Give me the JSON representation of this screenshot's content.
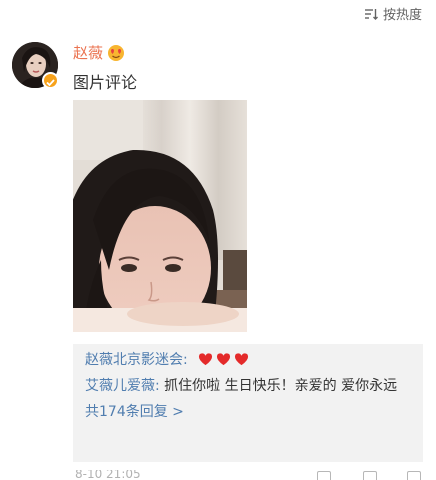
{
  "header": {
    "sort_label": "按热度",
    "sort_icon": "sort-lines-icon"
  },
  "comment": {
    "author": "赵薇",
    "author_badge_icon": "heart-eyes-emoji-icon",
    "verified_icon": "verified-check-icon",
    "text": "图片评论",
    "image": "selfie-photo"
  },
  "replies": {
    "items": [
      {
        "user": "赵薇北京影迷会:",
        "text": "",
        "emoji": [
          "red-heart-icon",
          "red-heart-icon",
          "red-heart-icon"
        ]
      },
      {
        "user": "艾薇儿爱薇:",
        "text": " 抓住你啦 生日快乐！亲爱的 爱你永远"
      }
    ],
    "more_label": "共174条回复 >"
  },
  "footer": {
    "timestamp": "8-10 21:05",
    "icons": [
      "share-icon",
      "comment-icon",
      "like-icon"
    ]
  },
  "colors": {
    "author": "#eb7350",
    "link": "#507daf",
    "reply_bg": "#f2f2f2",
    "verified": "#f7a21b"
  }
}
